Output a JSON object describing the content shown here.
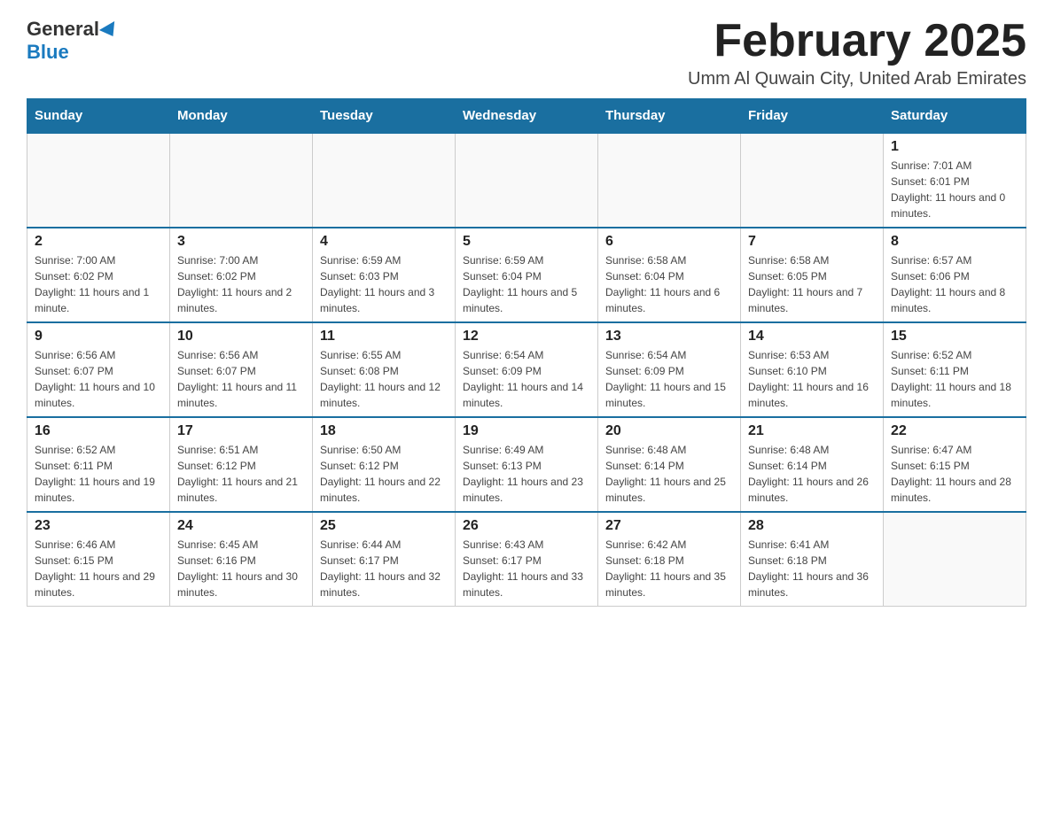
{
  "logo": {
    "general": "General",
    "blue": "Blue"
  },
  "header": {
    "month_title": "February 2025",
    "location": "Umm Al Quwain City, United Arab Emirates"
  },
  "days_of_week": [
    "Sunday",
    "Monday",
    "Tuesday",
    "Wednesday",
    "Thursday",
    "Friday",
    "Saturday"
  ],
  "weeks": [
    [
      {
        "day": "",
        "info": ""
      },
      {
        "day": "",
        "info": ""
      },
      {
        "day": "",
        "info": ""
      },
      {
        "day": "",
        "info": ""
      },
      {
        "day": "",
        "info": ""
      },
      {
        "day": "",
        "info": ""
      },
      {
        "day": "1",
        "info": "Sunrise: 7:01 AM\nSunset: 6:01 PM\nDaylight: 11 hours and 0 minutes."
      }
    ],
    [
      {
        "day": "2",
        "info": "Sunrise: 7:00 AM\nSunset: 6:02 PM\nDaylight: 11 hours and 1 minute."
      },
      {
        "day": "3",
        "info": "Sunrise: 7:00 AM\nSunset: 6:02 PM\nDaylight: 11 hours and 2 minutes."
      },
      {
        "day": "4",
        "info": "Sunrise: 6:59 AM\nSunset: 6:03 PM\nDaylight: 11 hours and 3 minutes."
      },
      {
        "day": "5",
        "info": "Sunrise: 6:59 AM\nSunset: 6:04 PM\nDaylight: 11 hours and 5 minutes."
      },
      {
        "day": "6",
        "info": "Sunrise: 6:58 AM\nSunset: 6:04 PM\nDaylight: 11 hours and 6 minutes."
      },
      {
        "day": "7",
        "info": "Sunrise: 6:58 AM\nSunset: 6:05 PM\nDaylight: 11 hours and 7 minutes."
      },
      {
        "day": "8",
        "info": "Sunrise: 6:57 AM\nSunset: 6:06 PM\nDaylight: 11 hours and 8 minutes."
      }
    ],
    [
      {
        "day": "9",
        "info": "Sunrise: 6:56 AM\nSunset: 6:07 PM\nDaylight: 11 hours and 10 minutes."
      },
      {
        "day": "10",
        "info": "Sunrise: 6:56 AM\nSunset: 6:07 PM\nDaylight: 11 hours and 11 minutes."
      },
      {
        "day": "11",
        "info": "Sunrise: 6:55 AM\nSunset: 6:08 PM\nDaylight: 11 hours and 12 minutes."
      },
      {
        "day": "12",
        "info": "Sunrise: 6:54 AM\nSunset: 6:09 PM\nDaylight: 11 hours and 14 minutes."
      },
      {
        "day": "13",
        "info": "Sunrise: 6:54 AM\nSunset: 6:09 PM\nDaylight: 11 hours and 15 minutes."
      },
      {
        "day": "14",
        "info": "Sunrise: 6:53 AM\nSunset: 6:10 PM\nDaylight: 11 hours and 16 minutes."
      },
      {
        "day": "15",
        "info": "Sunrise: 6:52 AM\nSunset: 6:11 PM\nDaylight: 11 hours and 18 minutes."
      }
    ],
    [
      {
        "day": "16",
        "info": "Sunrise: 6:52 AM\nSunset: 6:11 PM\nDaylight: 11 hours and 19 minutes."
      },
      {
        "day": "17",
        "info": "Sunrise: 6:51 AM\nSunset: 6:12 PM\nDaylight: 11 hours and 21 minutes."
      },
      {
        "day": "18",
        "info": "Sunrise: 6:50 AM\nSunset: 6:12 PM\nDaylight: 11 hours and 22 minutes."
      },
      {
        "day": "19",
        "info": "Sunrise: 6:49 AM\nSunset: 6:13 PM\nDaylight: 11 hours and 23 minutes."
      },
      {
        "day": "20",
        "info": "Sunrise: 6:48 AM\nSunset: 6:14 PM\nDaylight: 11 hours and 25 minutes."
      },
      {
        "day": "21",
        "info": "Sunrise: 6:48 AM\nSunset: 6:14 PM\nDaylight: 11 hours and 26 minutes."
      },
      {
        "day": "22",
        "info": "Sunrise: 6:47 AM\nSunset: 6:15 PM\nDaylight: 11 hours and 28 minutes."
      }
    ],
    [
      {
        "day": "23",
        "info": "Sunrise: 6:46 AM\nSunset: 6:15 PM\nDaylight: 11 hours and 29 minutes."
      },
      {
        "day": "24",
        "info": "Sunrise: 6:45 AM\nSunset: 6:16 PM\nDaylight: 11 hours and 30 minutes."
      },
      {
        "day": "25",
        "info": "Sunrise: 6:44 AM\nSunset: 6:17 PM\nDaylight: 11 hours and 32 minutes."
      },
      {
        "day": "26",
        "info": "Sunrise: 6:43 AM\nSunset: 6:17 PM\nDaylight: 11 hours and 33 minutes."
      },
      {
        "day": "27",
        "info": "Sunrise: 6:42 AM\nSunset: 6:18 PM\nDaylight: 11 hours and 35 minutes."
      },
      {
        "day": "28",
        "info": "Sunrise: 6:41 AM\nSunset: 6:18 PM\nDaylight: 11 hours and 36 minutes."
      },
      {
        "day": "",
        "info": ""
      }
    ]
  ]
}
